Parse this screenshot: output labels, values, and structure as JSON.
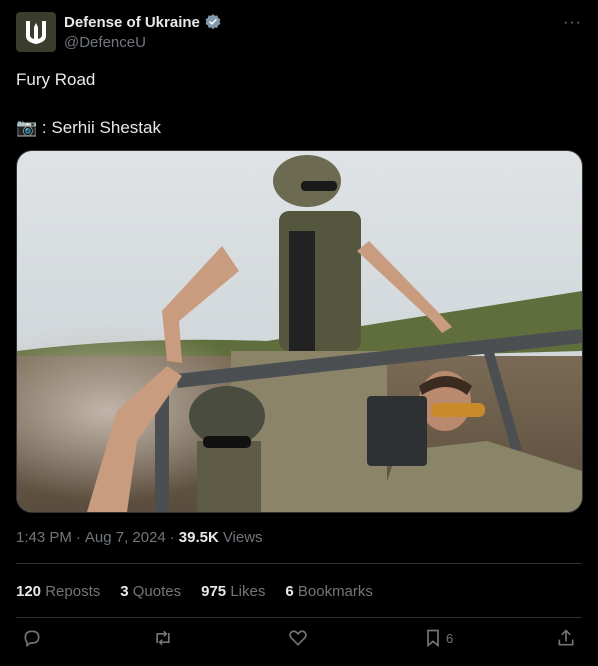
{
  "author": {
    "display_name": "Defense of Ukraine",
    "handle": "@DefenceU",
    "avatar_icon": "trident-icon",
    "verified_icon": "verified-badge-icon",
    "verified_color": "#829aab"
  },
  "menu": {
    "more_icon": "more-horizontal-icon",
    "more_label": "···"
  },
  "post": {
    "text_line1": "Fury Road",
    "photo_emoji": "📷",
    "credit": ": Serhii Shestak"
  },
  "media": {
    "alt": "Photo of soldiers riding in an open buggy on a dusty road"
  },
  "meta": {
    "time": "1:43 PM",
    "sep1": "·",
    "date": "Aug 7, 2024",
    "sep2": "·",
    "views_count": "39.5K",
    "views_label": "Views"
  },
  "stats": {
    "reposts_count": "120",
    "reposts_label": "Reposts",
    "quotes_count": "3",
    "quotes_label": "Quotes",
    "likes_count": "975",
    "likes_label": "Likes",
    "bookmarks_count": "6",
    "bookmarks_label": "Bookmarks"
  },
  "actions": {
    "reply_icon": "reply-icon",
    "repost_icon": "repost-icon",
    "like_icon": "heart-icon",
    "bookmark_icon": "bookmark-icon",
    "bookmark_count": "6",
    "share_icon": "share-icon"
  },
  "colors": {
    "background": "#000000",
    "text_primary": "#e7e9ea",
    "text_secondary": "#71767b",
    "divider": "#2f3336"
  }
}
